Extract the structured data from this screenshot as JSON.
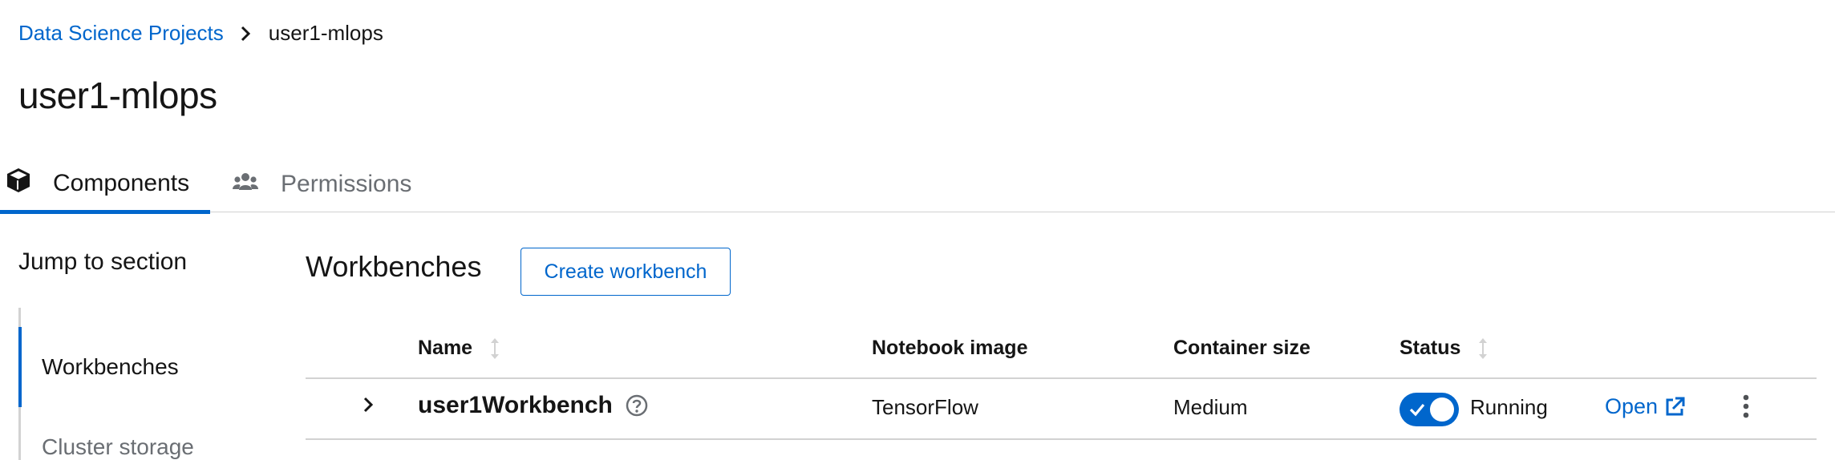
{
  "breadcrumb": {
    "parent": "Data Science Projects",
    "current": "user1-mlops"
  },
  "page": {
    "title": "user1-mlops"
  },
  "tabs": [
    {
      "label": "Components",
      "icon": "cube-icon",
      "active": true
    },
    {
      "label": "Permissions",
      "icon": "users-icon",
      "active": false
    }
  ],
  "jump": {
    "title": "Jump to section",
    "items": [
      {
        "label": "Workbenches",
        "active": true
      },
      {
        "label": "Cluster storage",
        "active": false
      }
    ]
  },
  "workbenches": {
    "title": "Workbenches",
    "create_label": "Create workbench",
    "columns": {
      "name": "Name",
      "image": "Notebook image",
      "size": "Container size",
      "status": "Status"
    },
    "rows": [
      {
        "name": "user1Workbench",
        "image": "TensorFlow",
        "size": "Medium",
        "status": "Running",
        "toggle_on": true,
        "open_label": "Open"
      }
    ]
  },
  "colors": {
    "accent": "#0066cc",
    "text": "#151515",
    "muted": "#6a6e73",
    "border": "#d2d2d2"
  }
}
